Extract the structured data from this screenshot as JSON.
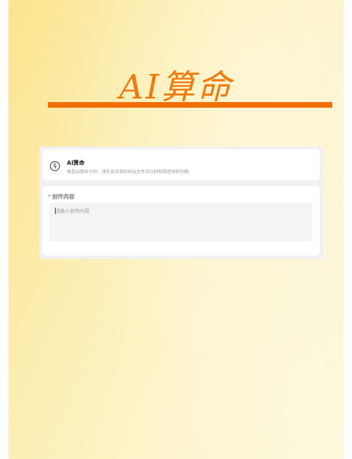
{
  "hero": {
    "title": "AI算命",
    "accent_color": "#ef7a0f",
    "bar_color": "#ef6f06"
  },
  "app_card": {
    "icon": "copyright-style-circle-icon",
    "icon_glyph": "§",
    "name": "AI算命",
    "description": "我是AI算命大师，请先告诉我你的出生年月日时和想咨询的问题"
  },
  "form": {
    "required_mark": "*",
    "label": "创作内容",
    "placeholder": "请输入创作内容",
    "value": ""
  }
}
